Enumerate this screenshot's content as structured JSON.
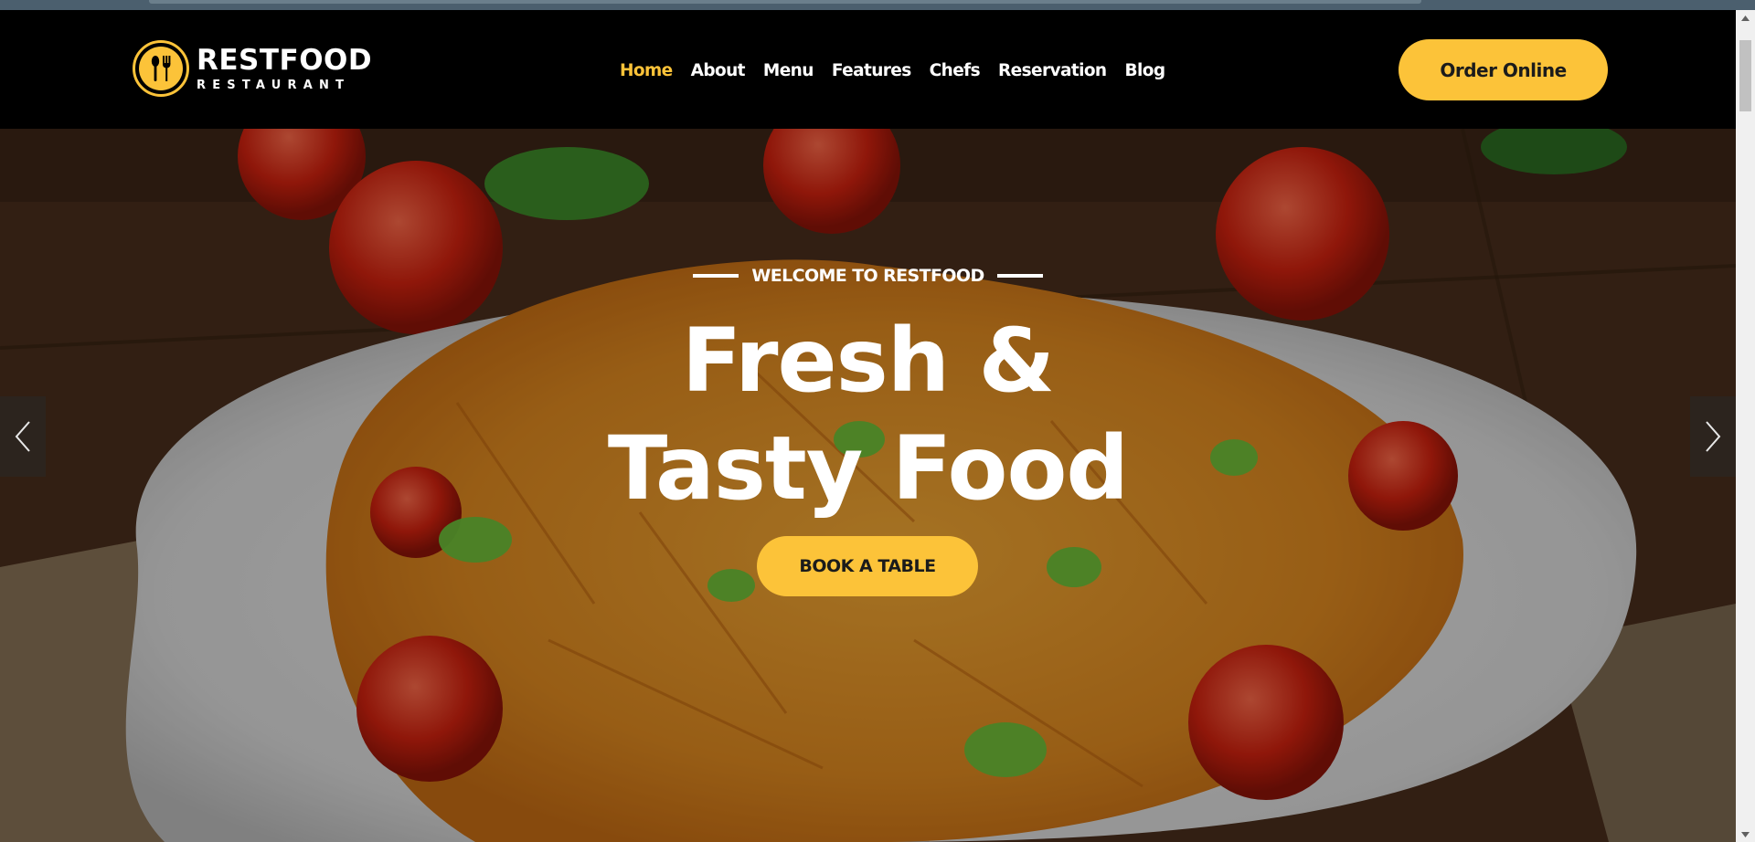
{
  "brand": {
    "name": "RESTFOOD",
    "subtitle": "RESTAURANT",
    "accent_color": "#fcc339",
    "logo_icon": "spoon-fork-icon"
  },
  "nav": {
    "items": [
      {
        "label": "Home",
        "active": true
      },
      {
        "label": "About",
        "active": false
      },
      {
        "label": "Menu",
        "active": false
      },
      {
        "label": "Features",
        "active": false
      },
      {
        "label": "Chefs",
        "active": false
      },
      {
        "label": "Reservation",
        "active": false
      },
      {
        "label": "Blog",
        "active": false
      }
    ],
    "cta_label": "Order Online"
  },
  "hero": {
    "eyebrow": "WELCOME TO RESTFOOD",
    "title_line1": "Fresh &",
    "title_line2": "Tasty Food",
    "button_label": "BOOK A TABLE",
    "prev_icon": "chevron-left-icon",
    "next_icon": "chevron-right-icon",
    "background": "pasta-plate-photo"
  }
}
